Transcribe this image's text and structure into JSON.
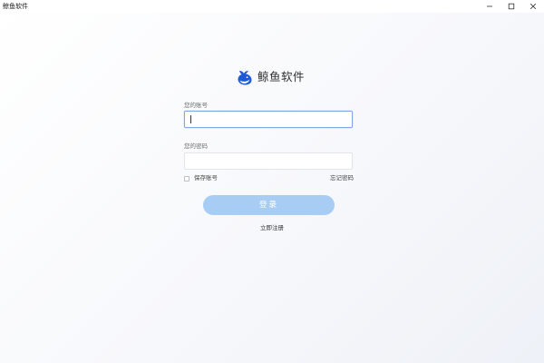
{
  "window": {
    "title": "鲸鱼软件",
    "controls": [
      "minimize",
      "maximize",
      "close"
    ]
  },
  "brand": {
    "name": "鲸鱼软件",
    "logo_icon": "whale-logo-icon",
    "logo_color": "#1f5ad6"
  },
  "form": {
    "account": {
      "label": "您的账号",
      "value": "",
      "placeholder": ""
    },
    "password": {
      "label": "您的密码",
      "value": "",
      "placeholder": ""
    },
    "remember": {
      "label": "保存账号",
      "checked": false
    },
    "forgot_label": "忘记密码",
    "login_label": "登录",
    "register_label": "立即注册"
  },
  "colors": {
    "accent": "#a8cdf5",
    "focus_border": "#7ea7e3",
    "text": "#333333"
  }
}
